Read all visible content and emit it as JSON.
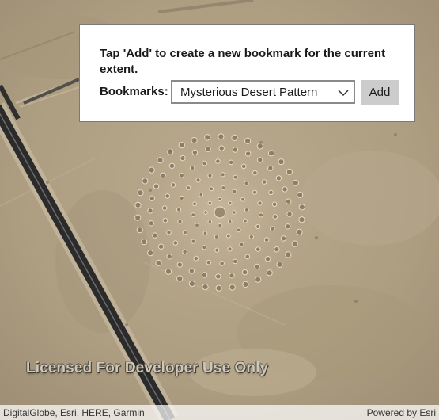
{
  "panel": {
    "instructions": "Tap 'Add' to create a new bookmark for the current extent.",
    "bookmarks_label": "Bookmarks:",
    "selected_bookmark": "Mysterious Desert Pattern",
    "add_label": "Add",
    "chevron_icon": "chevron-down-icon"
  },
  "map": {
    "watermark": "Licensed For Developer Use Only",
    "attribution": "DigitalGlobe, Esri, HERE, Garmin",
    "powered_by": "Powered by Esri"
  },
  "colors": {
    "desert": "#b3a286",
    "road": "#2b2b2b",
    "panel_border": "#7a7a7a",
    "button": "#cccccc"
  }
}
